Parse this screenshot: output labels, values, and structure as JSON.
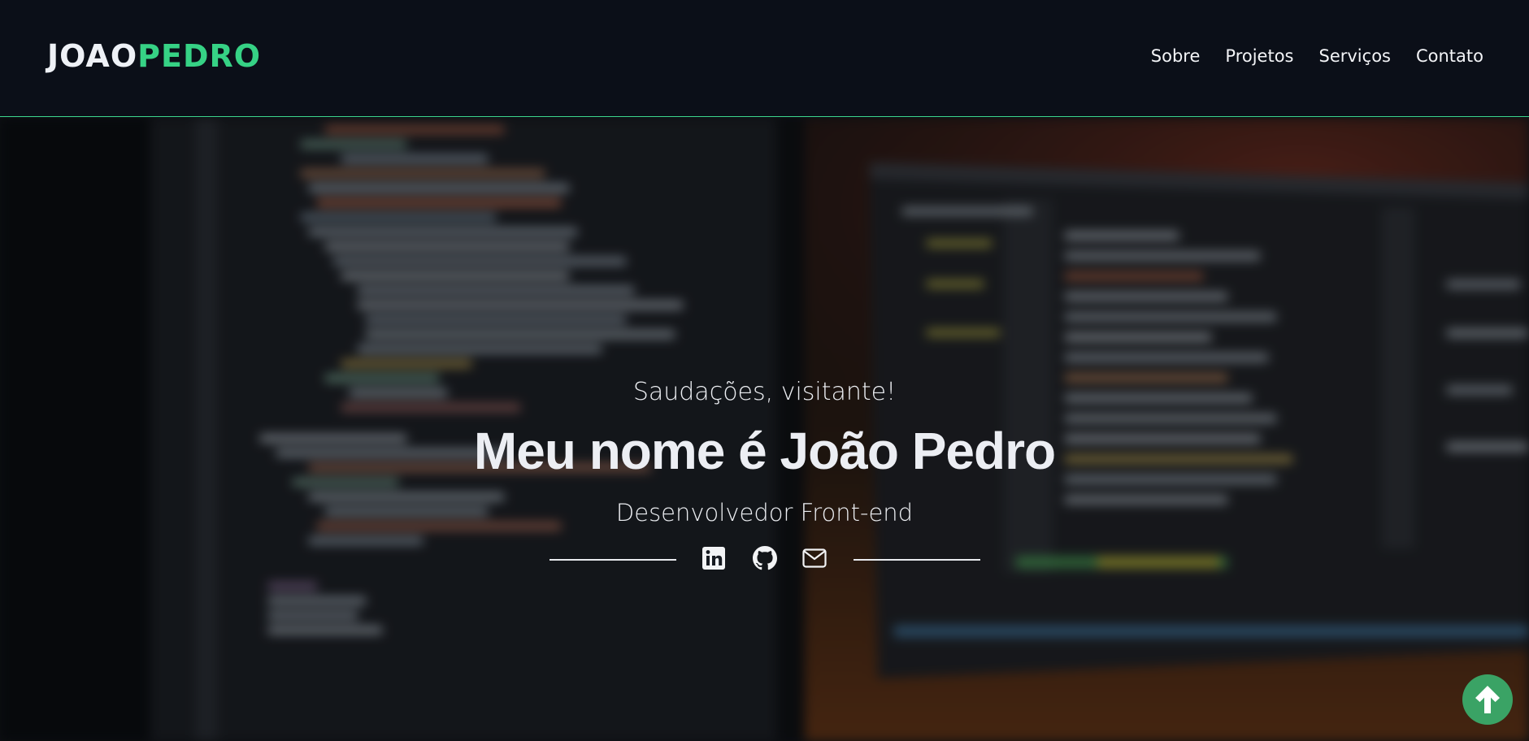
{
  "header": {
    "logo_part1": "JOAO",
    "logo_part2": "PEDRO",
    "nav": [
      {
        "label": "Sobre"
      },
      {
        "label": "Projetos"
      },
      {
        "label": "Serviços"
      },
      {
        "label": "Contato"
      }
    ]
  },
  "hero": {
    "greeting": "Saudações, visitante!",
    "title": "Meu nome é João Pedro",
    "subtitle": "Desenvolvedor Front-end",
    "social": [
      {
        "icon": "linkedin-icon"
      },
      {
        "icon": "github-icon"
      },
      {
        "icon": "email-icon"
      }
    ]
  },
  "scroll_top": {
    "icon": "arrow-up-icon"
  },
  "colors": {
    "accent": "#36d285",
    "header_bg": "#0b0f18",
    "text": "#eceef3",
    "scroll_button": "#3aa365"
  }
}
